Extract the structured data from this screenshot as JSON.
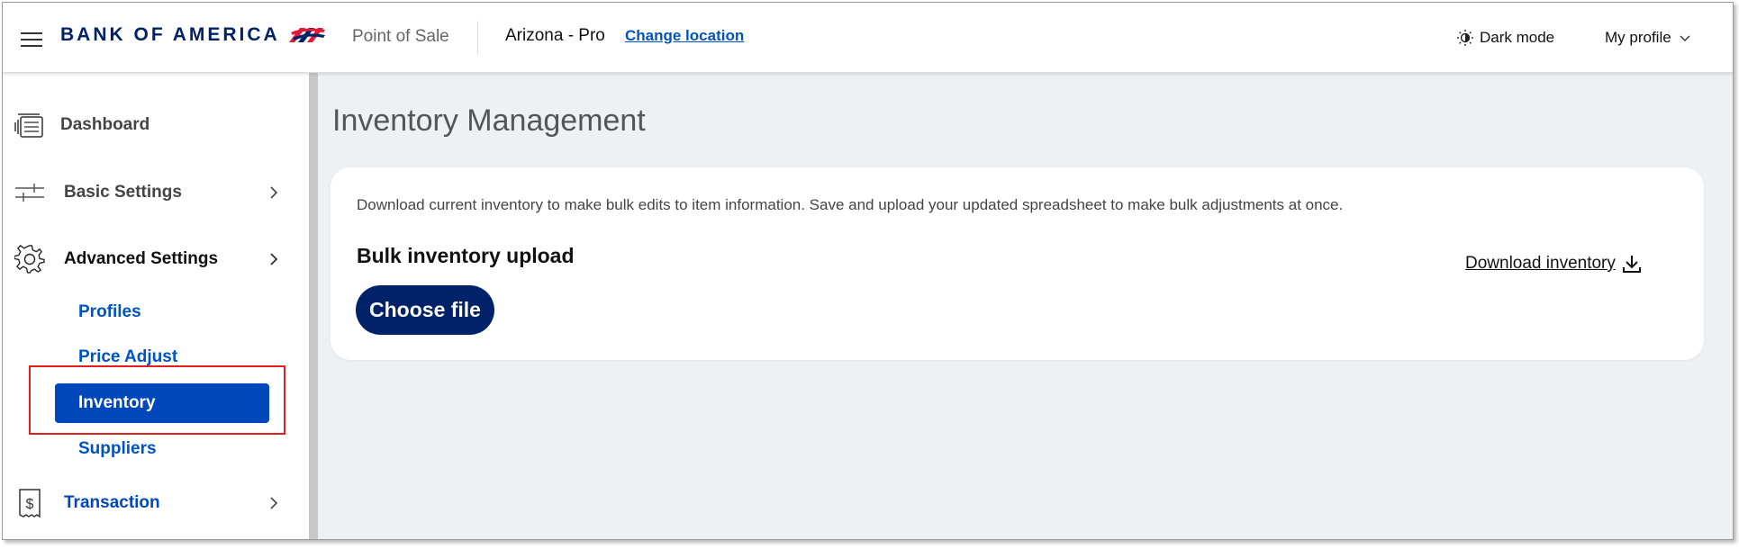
{
  "header": {
    "brand": "BANK OF AMERICA",
    "app_name": "Point of Sale",
    "location_name": "Arizona - Pro",
    "change_location": "Change location",
    "dark_mode": "Dark mode",
    "my_profile": "My profile"
  },
  "sidebar": {
    "items": [
      {
        "label": "Dashboard",
        "icon": "dashboard-icon"
      },
      {
        "label": "Basic Settings",
        "icon": "sliders-icon"
      },
      {
        "label": "Advanced Settings",
        "icon": "gear-icon"
      },
      {
        "label": "Transaction",
        "icon": "receipt-icon"
      }
    ],
    "sub_items": [
      {
        "label": "Profiles"
      },
      {
        "label": "Price Adjust"
      },
      {
        "label": "Inventory",
        "active": true
      },
      {
        "label": "Suppliers"
      }
    ]
  },
  "main": {
    "title": "Inventory Management",
    "description": "Download current inventory to make bulk edits to item information. Save and upload your updated spreadsheet to make bulk adjustments at once.",
    "upload_heading": "Bulk inventory upload",
    "choose_file": "Choose file",
    "download_inventory": "Download inventory"
  },
  "colors": {
    "brand_navy": "#012169",
    "link_blue": "#0053c2",
    "active_blue": "#0047bb",
    "highlight_red": "#e0201d",
    "main_bg": "#eff0f4"
  }
}
